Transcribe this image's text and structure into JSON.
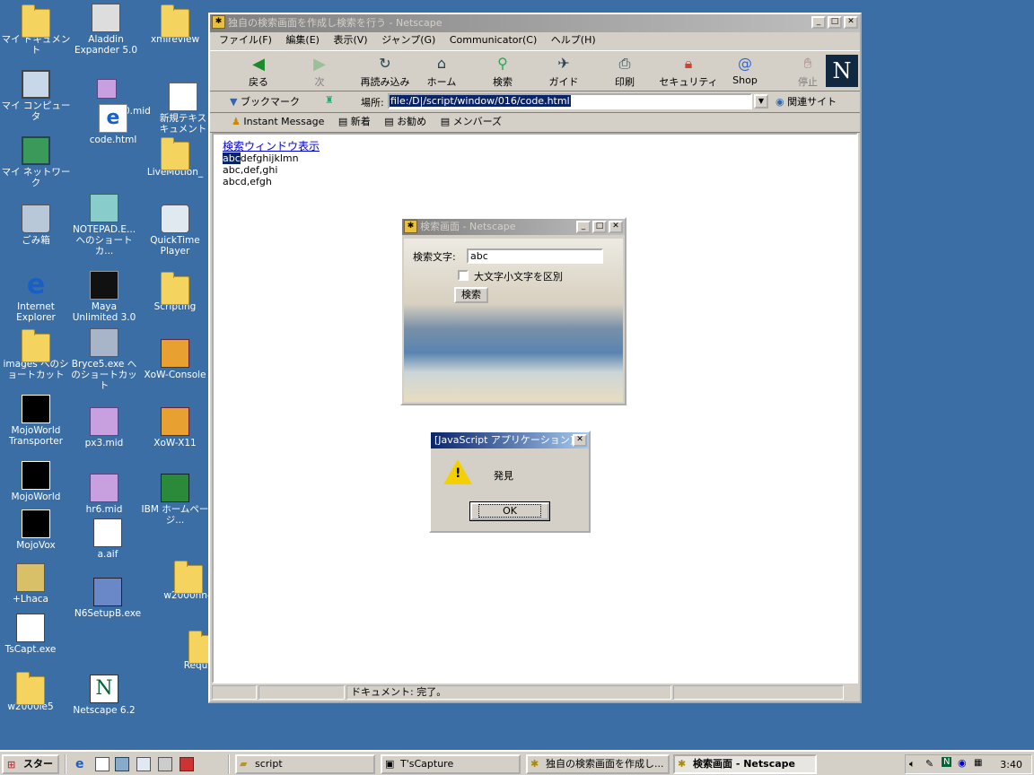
{
  "desktop_icons": [
    {
      "id": "my-documents",
      "label": "マイ ドキュメント"
    },
    {
      "id": "aladdin-expander",
      "label": "Aladdin Expander 5.0"
    },
    {
      "id": "xmlreview",
      "label": "xmlreview"
    },
    {
      "id": "my-computer",
      "label": "マイ コンピュータ"
    },
    {
      "id": "mid-file",
      "label": "0.mid"
    },
    {
      "id": "code-html",
      "label": "code.html"
    },
    {
      "id": "new-text",
      "label": "新規テキス キュメント"
    },
    {
      "id": "my-network",
      "label": "マイ ネットワーク"
    },
    {
      "id": "livemotion",
      "label": "LiveMotion_"
    },
    {
      "id": "recycle-bin",
      "label": "ごみ箱"
    },
    {
      "id": "notepad-shortcut",
      "label": "NOTEPAD.E... へのショートカ..."
    },
    {
      "id": "quicktime",
      "label": "QuickTime Player"
    },
    {
      "id": "internet-explorer",
      "label": "Internet Explorer"
    },
    {
      "id": "maya",
      "label": "Maya Unlimited 3.0"
    },
    {
      "id": "scripting",
      "label": "Scripting"
    },
    {
      "id": "images-shortcut",
      "label": "images へのシ ョートカット"
    },
    {
      "id": "bryce",
      "label": "Bryce5.exe へ のショートカット"
    },
    {
      "id": "xow-console",
      "label": "XoW-Console"
    },
    {
      "id": "mojoworld-transporter",
      "label": "MojoWorld Transporter"
    },
    {
      "id": "px3-mid",
      "label": "px3.mid"
    },
    {
      "id": "xow-x11",
      "label": "XoW-X11"
    },
    {
      "id": "mojoworld",
      "label": "MojoWorld"
    },
    {
      "id": "hr6-mid",
      "label": "hr6.mid"
    },
    {
      "id": "ibm-homepage",
      "label": "IBM ホームページ..."
    },
    {
      "id": "mojovox",
      "label": "MojoVox"
    },
    {
      "id": "a-aif",
      "label": "a.aif"
    },
    {
      "id": "lhaca",
      "label": "+Lhaca"
    },
    {
      "id": "n6setup",
      "label": "N6SetupB.exe"
    },
    {
      "id": "w2000nn4",
      "label": "w2000nn4"
    },
    {
      "id": "tscapt",
      "label": "TsCapt.exe"
    },
    {
      "id": "requ",
      "label": "Requ"
    },
    {
      "id": "w2000ie5",
      "label": "w2000ie5"
    },
    {
      "id": "netscape62",
      "label": "Netscape 6.2"
    }
  ],
  "main_window": {
    "title": "独自の検索画面を作成し検索を行う - Netscape",
    "menu": [
      "ファイル(F)",
      "編集(E)",
      "表示(V)",
      "ジャンプ(G)",
      "Communicator(C)",
      "ヘルプ(H)"
    ],
    "nav_buttons": [
      {
        "id": "back",
        "label": "戻る"
      },
      {
        "id": "forward",
        "label": "次"
      },
      {
        "id": "reload",
        "label": "再読み込み"
      },
      {
        "id": "home",
        "label": "ホーム"
      },
      {
        "id": "search",
        "label": "検索"
      },
      {
        "id": "guide",
        "label": "ガイド"
      },
      {
        "id": "print",
        "label": "印刷"
      },
      {
        "id": "security",
        "label": "セキュリティ"
      },
      {
        "id": "shop",
        "label": "Shop"
      },
      {
        "id": "stop",
        "label": "停止"
      }
    ],
    "bookmarks_label": "ブックマーク",
    "location_label": "場所:",
    "location_value": "file:/D|/script/window/016/code.html",
    "related_label": "関連サイト",
    "personal_toolbar": [
      "Instant Message",
      "新着",
      "お勧め",
      "メンバーズ"
    ],
    "content": {
      "link": "検索ウィンドウ表示",
      "highlight": "abc",
      "line1_rest": "defghijklmn",
      "line2": "abc,def,ghi",
      "line3": "abcd,efgh"
    },
    "status_text": "ドキュメント: 完了。"
  },
  "search_window": {
    "title": "検索画面 - Netscape",
    "field_label": "検索文字:",
    "field_value": "abc",
    "checkbox_label": "大文字小文字を区別",
    "button_label": "検索"
  },
  "alert": {
    "title": "[JavaScript アプリケーション]",
    "message": "発見",
    "ok_label": "OK"
  },
  "taskbar": {
    "start_label": "スタート",
    "tasks": [
      {
        "id": "script",
        "label": "script"
      },
      {
        "id": "tscapture",
        "label": "T'sCapture"
      },
      {
        "id": "main",
        "label": "独自の検索画面を作成し..."
      },
      {
        "id": "search",
        "label": "検索画面 - Netscape"
      }
    ],
    "clock": "3:40"
  }
}
